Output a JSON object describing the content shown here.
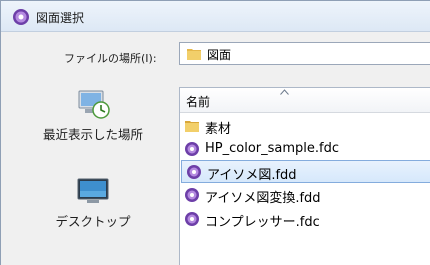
{
  "window": {
    "title": "図面選択"
  },
  "lookin": {
    "label": "ファイルの場所(I):",
    "value": "図面"
  },
  "places": [
    {
      "label": "最近表示した場所",
      "icon": "recent-places-icon"
    },
    {
      "label": "デスクトップ",
      "icon": "desktop-icon"
    }
  ],
  "file_list": {
    "column_header": "名前",
    "items": [
      {
        "label": "素材",
        "icon": "folder-icon",
        "selected": false
      },
      {
        "label": "HP_color_sample.fdc",
        "icon": "app-file-icon",
        "selected": false
      },
      {
        "label": "アイソメ図.fdd",
        "icon": "app-file-icon",
        "selected": true
      },
      {
        "label": "アイソメ図変換.fdd",
        "icon": "app-file-icon",
        "selected": false
      },
      {
        "label": "コンプレッサー.fdc",
        "icon": "app-file-icon",
        "selected": false
      }
    ]
  },
  "colors": {
    "selection": "#d6e8fb",
    "selection_border": "#84acdd",
    "folder": "#e6b84a"
  }
}
